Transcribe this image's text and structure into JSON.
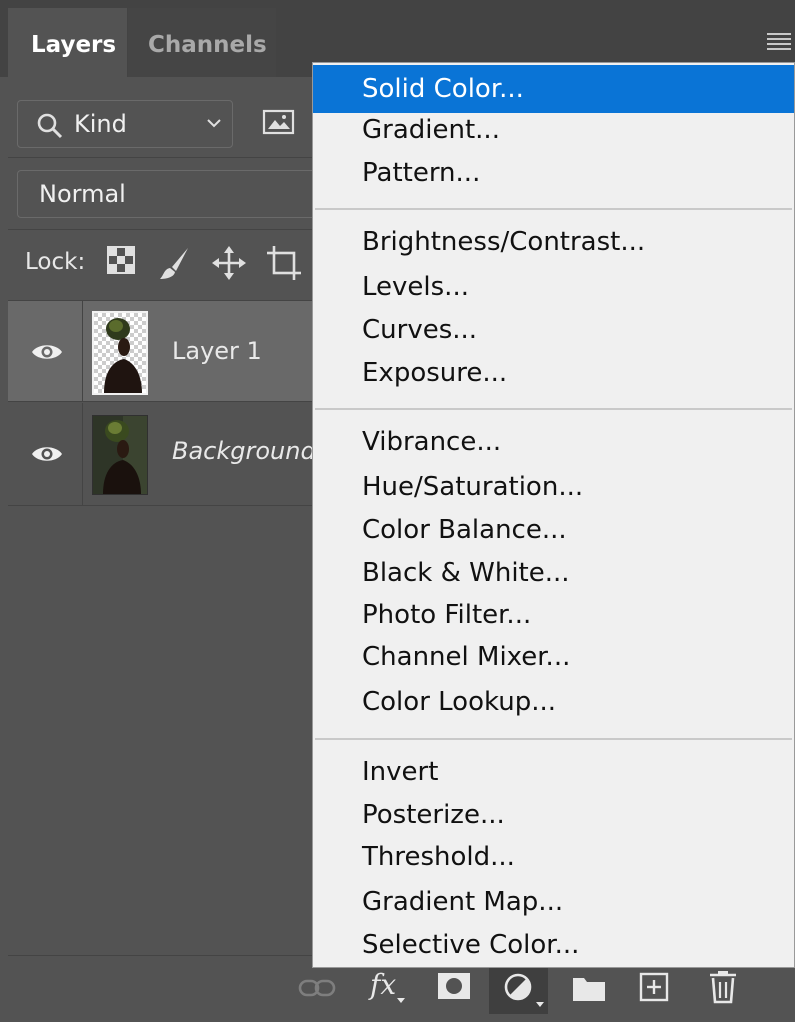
{
  "tabs": [
    {
      "label": "Layers",
      "active": true
    },
    {
      "label": "Channels",
      "active": false
    }
  ],
  "filter": {
    "kind_label": "Kind"
  },
  "blend": {
    "mode": "Normal"
  },
  "lock": {
    "label": "Lock:"
  },
  "layers": [
    {
      "name": "Layer 1",
      "visible": true,
      "selected": true
    },
    {
      "name": "Background",
      "visible": true,
      "selected": false
    }
  ],
  "menu": {
    "groups": [
      [
        "Solid Color...",
        "Gradient...",
        "Pattern..."
      ],
      [
        "Brightness/Contrast...",
        "Levels...",
        "Curves...",
        "Exposure..."
      ],
      [
        "Vibrance...",
        "Hue/Saturation...",
        "Color Balance...",
        "Black & White...",
        "Photo Filter...",
        "Channel Mixer...",
        "Color Lookup..."
      ],
      [
        "Invert",
        "Posterize...",
        "Threshold...",
        "Gradient Map...",
        "Selective Color..."
      ]
    ],
    "highlighted": "Solid Color..."
  },
  "footer": {
    "icons": [
      "link-icon",
      "fx-icon",
      "mask-icon",
      "adjustment-icon",
      "folder-icon",
      "new-layer-icon",
      "trash-icon"
    ],
    "fx_label": "fx"
  },
  "colors": {
    "panel_bg": "#535353",
    "tab_strip_bg": "#434343",
    "selected_row_bg": "#696969",
    "menu_bg": "#f0f0f0",
    "menu_highlight": "#0a74d6"
  }
}
